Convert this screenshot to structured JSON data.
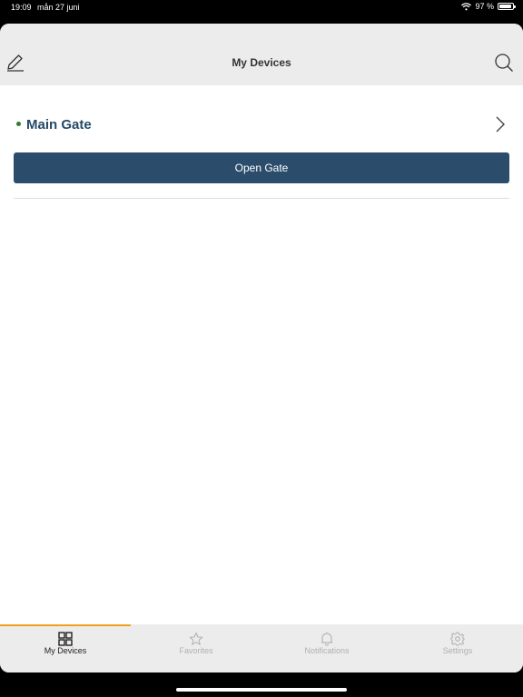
{
  "status_bar": {
    "time": "19:09",
    "date": "mån 27 juni",
    "battery": "97 %",
    "battery_level": 0.97
  },
  "navbar": {
    "title": "My Devices",
    "edit_icon": "pencil-icon",
    "search_icon": "search-icon"
  },
  "devices": [
    {
      "name": "Main Gate",
      "status": "online",
      "status_color": "#2e7d32",
      "action_label": "Open Gate"
    }
  ],
  "tabs": [
    {
      "label": "My Devices",
      "icon": "grid-icon",
      "active": true
    },
    {
      "label": "Favorites",
      "icon": "star-icon",
      "active": false
    },
    {
      "label": "Notifications",
      "icon": "bell-icon",
      "active": false
    },
    {
      "label": "Settings",
      "icon": "gear-icon",
      "active": false
    }
  ],
  "colors": {
    "accent": "#f0a020",
    "button": "#2b4d6b",
    "device_name": "#244a66"
  }
}
